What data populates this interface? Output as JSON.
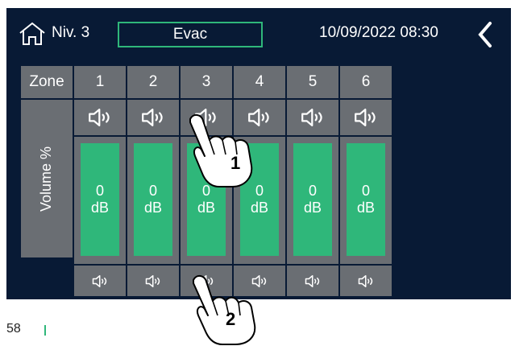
{
  "header": {
    "level": "Niv. 3",
    "mode": "Evac",
    "datetime": "10/09/2022 08:30"
  },
  "table": {
    "zone_label": "Zone",
    "volume_label": "Volume %",
    "zones": [
      "1",
      "2",
      "3",
      "4",
      "5",
      "6"
    ],
    "volume_value": "0",
    "volume_unit": "dB"
  },
  "callouts": [
    "1",
    "2"
  ],
  "page_number": "58",
  "colors": {
    "background": "#081a35",
    "cell": "#6a6e73",
    "accent": "#2fb77a"
  },
  "icons": [
    "home-icon",
    "back-icon",
    "speaker-icon",
    "hand-icon"
  ]
}
